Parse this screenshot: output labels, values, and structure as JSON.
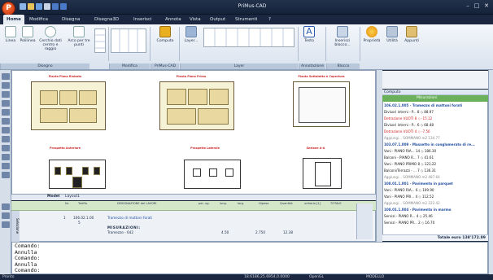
{
  "app": {
    "title": "PriMus-CAD",
    "logo_letter": "P"
  },
  "window_controls": {
    "minimize": "–",
    "maximize": "□",
    "close": "✕"
  },
  "tabs": [
    "Home",
    "Modifica",
    "Disegna",
    "Disegna3D",
    "Inserisci",
    "Annota",
    "Vista",
    "Output",
    "Strumenti",
    "?"
  ],
  "ribbon": {
    "buttons": [
      "Linea",
      "Polilinea",
      "Cerchio dati centro e raggio",
      "Arco per tre punti",
      "Computo",
      "Layer...",
      "Testo",
      "Inserisci blocco...",
      "Proprietà",
      "Utilità",
      "Appunti"
    ],
    "groups": [
      "Disegno",
      "Modifica",
      "PriMus-CAD",
      "Layer",
      "Annotazione",
      "Blocco"
    ]
  },
  "drawing": {
    "titles": [
      "Pianta Piano Rialzato",
      "Pianta Piano Primo",
      "Pianta Sottotetto e Copertura",
      "Prospetto Anteriore",
      "Prospetto Laterale",
      "Sezione A-A"
    ]
  },
  "model_tabs": {
    "model": "Model",
    "layout": "Layout1"
  },
  "right_panel": {
    "header": "Computo",
    "column": "Misurazioni",
    "lines": [
      {
        "t": "106.02.1.005 - Tramezzo di mattoni forati",
        "c": "rsect"
      },
      {
        "t": "Divisori interni - P...       8 ◇   88.97",
        "c": ""
      },
      {
        "t": "Detrazione VUOTI         8 ◇  -15.12",
        "c": "rred"
      },
      {
        "t": "Divisori interni - P...       6 ◇   68.48",
        "c": ""
      },
      {
        "t": "Detrazione VUOTI         4 ◇   -7.56",
        "c": "rred"
      },
      {
        "t": "Aggiungi...            SOMMANO m2  134.77",
        "c": "rgray"
      },
      {
        "t": "103.07.1.009 - Massetto in conglomerato di re...",
        "c": "rsect"
      },
      {
        "t": "Vani - PIANO RIA...     14 ◇  186.30",
        "c": ""
      },
      {
        "t": "Balconi - PIANO R...      7 ◇   41.61",
        "c": ""
      },
      {
        "t": "Vani - PIANO PRIMO     8 ◇  123.22",
        "c": ""
      },
      {
        "t": "Balconi/Terrazzi - ...      7 ◇  136.31",
        "c": ""
      },
      {
        "t": "Aggiungi...            SOMMANO m2  487.64",
        "c": "rgray"
      },
      {
        "t": "108.01.1.001 - Pavimento in parquet",
        "c": "rsect"
      },
      {
        "t": "Vani - PIANO RIA...      6 ◇  109.90",
        "c": ""
      },
      {
        "t": "Vani - PIANO PRI...      4 ◇  112.52",
        "c": ""
      },
      {
        "t": "Aggiungi...            SOMMANO m2  222.42",
        "c": "rgray"
      },
      {
        "t": "108.01.1.004 - Pavimento in marmo",
        "c": "rsect"
      },
      {
        "t": "Servizi - PIANO R...      4 ◇   25.46",
        "c": ""
      },
      {
        "t": "Servizi - PIANO PR...     2 ◇   16.70",
        "c": ""
      }
    ],
    "total": "Totale  euro  138'172.89"
  },
  "table": {
    "headers": [
      "Nr.",
      "Tariffa",
      "DESIGNAZIONE dei LAVORI",
      "par. ug.",
      "lung.",
      "larg.",
      "H/peso",
      "Quantità",
      "unitario [1]",
      "TOTALE"
    ],
    "row1": {
      "nr": "1",
      "code": "106.02.1.00",
      "desc": "Tramezzo di mattoni forati"
    },
    "row2": {
      "nr": "5",
      "desc": "MISURAZIONI:"
    },
    "row3": {
      "desc": "Tramezzo - 642",
      "lung": "4.50",
      "h": "2.750",
      "qty": "12.38"
    },
    "side_label": "Selezione"
  },
  "command": [
    "Comando:",
    "Annulla",
    "Comando:",
    "Annulla",
    "Comando:"
  ],
  "status": {
    "left": "Pronto",
    "coords": "18.6186,25.6954,0.0000",
    "mode": "OpenGL",
    "model": "MODELLO"
  }
}
